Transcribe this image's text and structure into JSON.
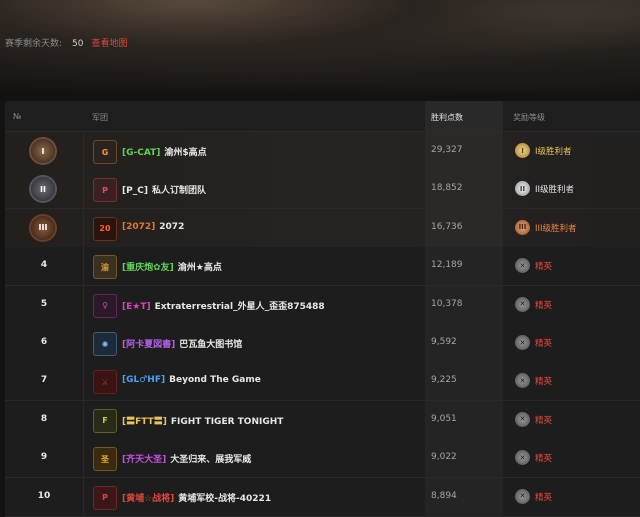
{
  "season": {
    "days_label": "赛季剩余天数:",
    "days_value": "50",
    "map_link": "查看地图"
  },
  "table": {
    "headers": {
      "rank": "№",
      "clan": "军团",
      "points": "胜利点数",
      "reward": "奖励等级"
    },
    "rows": [
      {
        "rank": "I",
        "medal": "gold",
        "tag": "[G-CAT]",
        "tag_color": "#5fd25a",
        "name": "渝州$高点",
        "points": "29,327",
        "reward": "I级胜利者",
        "reward_type": "gold",
        "reward_color": "#e8c35a",
        "reward_glyph": "I",
        "logo_icon": "gcat-logo-icon",
        "logo_bg": "#2b2320",
        "logo_fg": "#f0a030",
        "logo_char": "G"
      },
      {
        "rank": "II",
        "medal": "silver",
        "tag": "[P_C]",
        "tag_color": "#e6e6e6",
        "name": "私人订制团队",
        "points": "18,852",
        "reward": "II级胜利者",
        "reward_type": "silver",
        "reward_color": "#e6e6e6",
        "reward_glyph": "II",
        "logo_icon": "pc-logo-icon",
        "logo_bg": "#3a2020",
        "logo_fg": "#e05060",
        "logo_char": "P"
      },
      {
        "rank": "III",
        "medal": "bronze",
        "tag": "[2072]",
        "tag_color": "#e0772e",
        "name": "2072",
        "points": "16,736",
        "reward": "III级胜利者",
        "reward_type": "bronze",
        "reward_color": "#e0884a",
        "reward_glyph": "III",
        "logo_icon": "2072-logo-icon",
        "logo_bg": "#2a1410",
        "logo_fg": "#ff6020",
        "logo_char": "20"
      },
      {
        "rank": "4",
        "medal": "",
        "tag": "[重庆炮✿友]",
        "tag_color": "#5fd25a",
        "name": "渝州★高点",
        "points": "12,189",
        "reward": "精英",
        "reward_type": "elite",
        "reward_color": "#e0463c",
        "reward_glyph": "✕",
        "logo_icon": "chongqing-logo-icon",
        "logo_bg": "#3a3020",
        "logo_fg": "#e0a040",
        "logo_char": "渝"
      },
      {
        "rank": "5",
        "medal": "",
        "tag": "[E★T]",
        "tag_color": "#e040c0",
        "name": "Extraterrestrial_外星人_歪歪875488",
        "points": "10,378",
        "reward": "精英",
        "reward_type": "elite",
        "reward_color": "#e0463c",
        "reward_glyph": "✕",
        "logo_icon": "et-logo-icon",
        "logo_bg": "#2a1a28",
        "logo_fg": "#e040c0",
        "logo_char": "♀"
      },
      {
        "rank": "6",
        "medal": "",
        "tag": "[阿卡夏図書]",
        "tag_color": "#b060e0",
        "name": "巴瓦鱼大图书馆",
        "points": "9,592",
        "reward": "精英",
        "reward_type": "elite",
        "reward_color": "#e0463c",
        "reward_glyph": "✕",
        "logo_icon": "akasha-logo-icon",
        "logo_bg": "#1e2a3a",
        "logo_fg": "#7ac0f0",
        "logo_char": "✺"
      },
      {
        "rank": "7",
        "medal": "",
        "tag": "[GL♂HF]",
        "tag_color": "#4aa0f0",
        "name": "Beyond The Game",
        "points": "9,225",
        "reward": "精英",
        "reward_type": "elite",
        "reward_color": "#e0463c",
        "reward_glyph": "✕",
        "logo_icon": "horde-logo-icon",
        "logo_bg": "#3a1414",
        "logo_fg": "#c83030",
        "logo_char": "⚔"
      },
      {
        "rank": "8",
        "medal": "",
        "tag": "[〓FTT〓]",
        "tag_color": "#e8c35a",
        "name": "FIGHT TIGER TONIGHT",
        "points": "9,051",
        "reward": "精英",
        "reward_type": "elite",
        "reward_color": "#e0463c",
        "reward_glyph": "✕",
        "logo_icon": "ftt-logo-icon",
        "logo_bg": "#2a2a18",
        "logo_fg": "#d8c040",
        "logo_char": "F"
      },
      {
        "rank": "9",
        "medal": "",
        "tag": "[齐天大圣]",
        "tag_color": "#c050e0",
        "name": "大圣归来、展我军威",
        "points": "9,022",
        "reward": "精英",
        "reward_type": "elite",
        "reward_color": "#e0463c",
        "reward_glyph": "✕",
        "logo_icon": "monkey-king-logo-icon",
        "logo_bg": "#3a2a10",
        "logo_fg": "#e8b030",
        "logo_char": "圣"
      },
      {
        "rank": "10",
        "medal": "",
        "tag": "[黄埔☆战将]",
        "tag_color": "#e0463c",
        "name": "黄埔军校-战将-40221",
        "points": "8,894",
        "reward": "精英",
        "reward_type": "elite",
        "reward_color": "#e0463c",
        "reward_glyph": "✕",
        "logo_icon": "huangpu-logo-icon",
        "logo_bg": "#3a1818",
        "logo_fg": "#e04040",
        "logo_char": "P"
      }
    ]
  }
}
